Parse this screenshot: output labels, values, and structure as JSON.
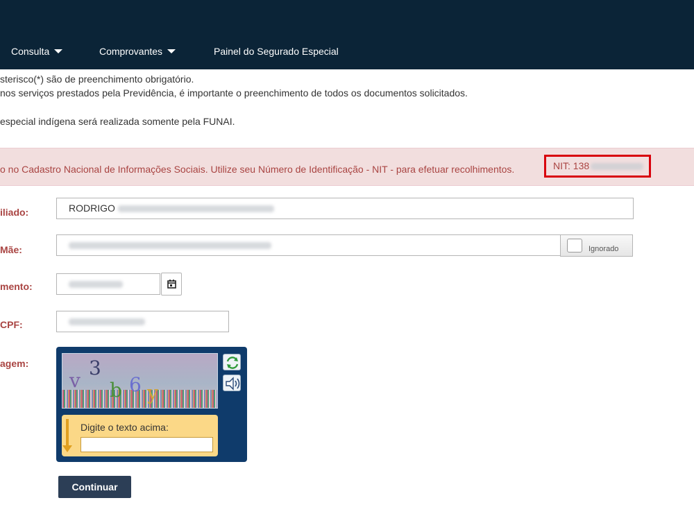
{
  "nav": {
    "items": [
      {
        "label": "Consulta",
        "has_dropdown": true
      },
      {
        "label": "Comprovantes",
        "has_dropdown": true
      },
      {
        "label": "Painel do Segurado Especial",
        "has_dropdown": false
      }
    ]
  },
  "info": {
    "line1": "sterisco(*) são de preenchimento obrigatório.",
    "line2": "nos serviços prestados pela Previdência, é importante o preenchimento de todos os documentos solicitados.",
    "line3": "especial indígena será realizada somente pela FUNAI."
  },
  "alert": {
    "message": "o no Cadastro Nacional de Informações Sociais. Utilize seu Número de Identificação - NIT - para efetuar recolhimentos.",
    "nit_visible": "NIT: 138"
  },
  "form": {
    "name": {
      "label": "iliado:",
      "visible_value": "RODRIGO"
    },
    "mother": {
      "label": "Mãe:",
      "ignore_label": "Ignorado"
    },
    "birth": {
      "label": "mento:"
    },
    "cpf": {
      "label": "CPF:"
    },
    "captcha": {
      "label": "agem:",
      "prompt": "Digite o texto acima:",
      "chars": [
        "v",
        "3",
        "b",
        "6",
        "y"
      ]
    },
    "continue_label": "Continuar"
  },
  "colors": {
    "header_bg": "#0b2437",
    "alert_bg": "#f2dede",
    "alert_text": "#a94442",
    "highlight_box": "#d8000c",
    "captcha_bg": "#0f3b6b",
    "button_bg": "#2c3e56"
  },
  "icons": [
    "caret-down-icon",
    "calendar-icon",
    "refresh-captcha-icon",
    "audio-captcha-icon",
    "arrow-down-icon"
  ]
}
